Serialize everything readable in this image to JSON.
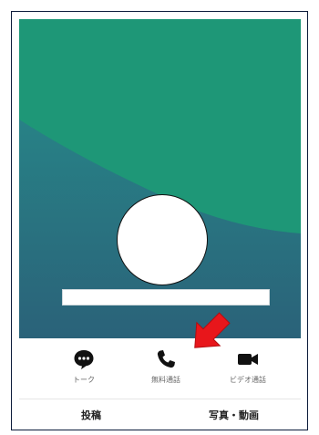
{
  "profile": {
    "cover_colors": {
      "upper": "#1e9777",
      "lower": "#2a6f82"
    }
  },
  "actions": [
    {
      "label": "トーク",
      "icon": "chat-bubble-icon"
    },
    {
      "label": "無料通話",
      "icon": "phone-icon"
    },
    {
      "label": "ビデオ通話",
      "icon": "video-camera-icon"
    }
  ],
  "tabs": [
    {
      "label": "投稿"
    },
    {
      "label": "写真・動画"
    }
  ],
  "annotation": {
    "arrow_color": "#e8161b",
    "points_to": "video-call"
  }
}
